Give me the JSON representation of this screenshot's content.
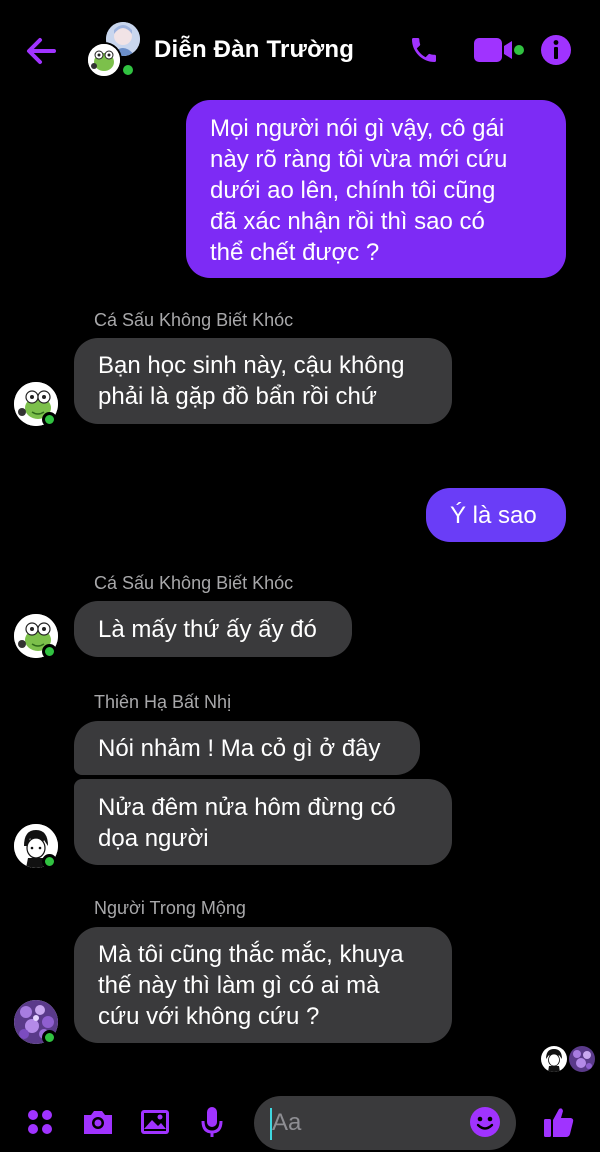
{
  "header": {
    "title": "Diễn Đàn Trường"
  },
  "colors": {
    "accent": "#a033ff",
    "outgoing_bubble": "#7d2bf5",
    "incoming_bubble": "#3a3a3c",
    "online": "#31c241"
  },
  "messages": [
    {
      "from": "me",
      "text_lines": [
        "Mọi người nói gì vậy, cô gái",
        "này rõ ràng tôi vừa mới cứu",
        "dưới ao lên, chính tôi cũng",
        "đã xác nhận rồi thì sao có",
        "thể chết được ?"
      ]
    },
    {
      "from": "other",
      "sender": "Cá Sấu Không Biết Khóc",
      "text_lines": [
        "Bạn học sinh này, cậu không",
        "phải là gặp đồ bẩn rồi chứ"
      ]
    },
    {
      "from": "me",
      "text_lines": [
        "Ý là sao"
      ]
    },
    {
      "from": "other",
      "sender": "Cá Sấu Không Biết Khóc",
      "text_lines": [
        "Là mấy thứ ấy ấy đó"
      ]
    },
    {
      "from": "other",
      "sender": "Thiên Hạ Bất Nhị",
      "text_lines": [
        "Nói nhảm ! Ma cỏ gì ở đây"
      ]
    },
    {
      "from": "other",
      "text_lines": [
        "Nửa đêm nửa hôm đừng có",
        "dọa người"
      ]
    },
    {
      "from": "other",
      "sender": "Người Trong Mộng",
      "text_lines": [
        "Mà tôi cũng thắc mắc, khuya",
        "thế này thì làm gì có ai mà",
        "cứu với không cứu ?"
      ]
    }
  ],
  "composer": {
    "placeholder": "Aa"
  },
  "icons": {
    "back": "arrow-left-icon",
    "call": "phone-icon",
    "video": "video-camera-icon",
    "info": "info-icon",
    "menu": "four-dots-icon",
    "camera": "camera-icon",
    "gallery": "image-icon",
    "mic": "microphone-icon",
    "emoji": "smiley-icon",
    "like": "thumbs-up-icon"
  }
}
